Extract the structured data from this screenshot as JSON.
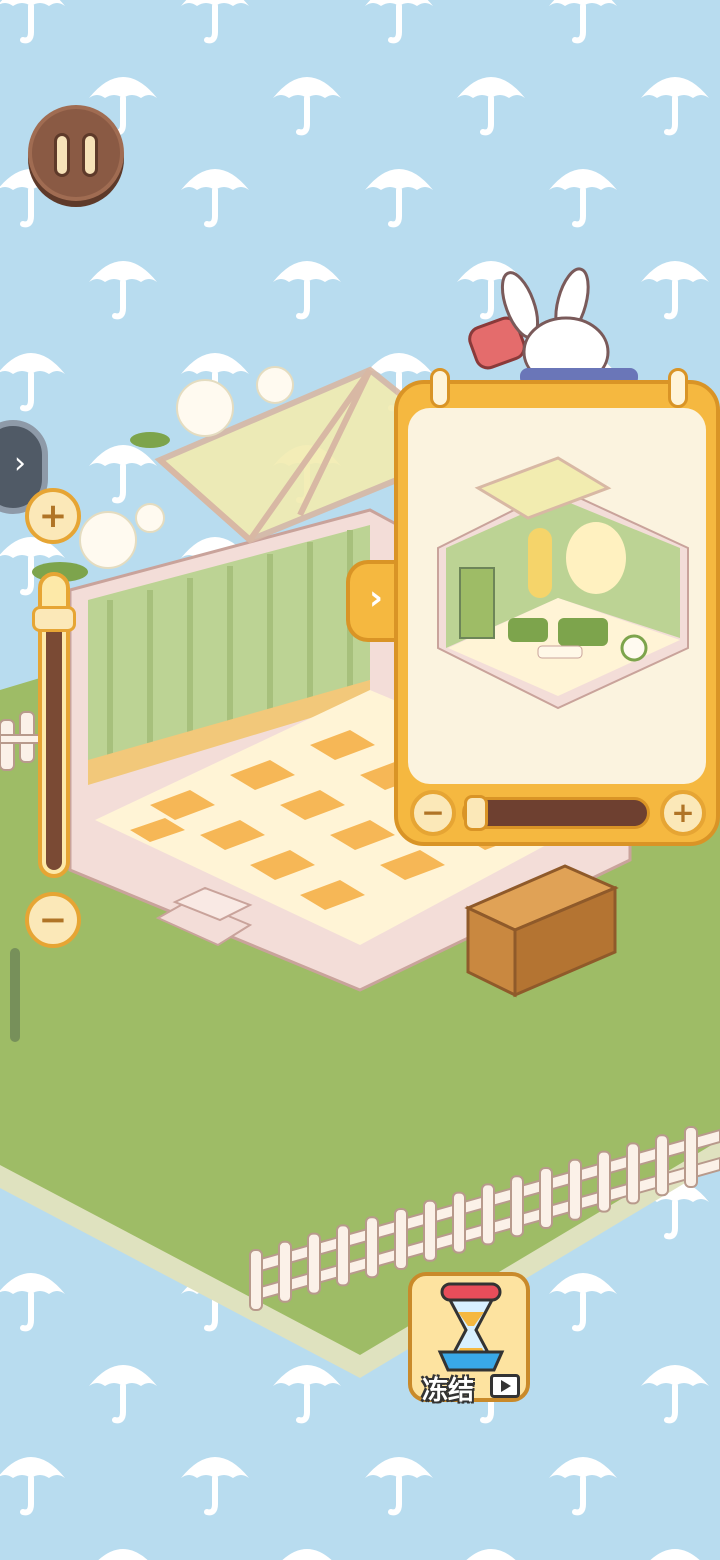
{
  "colors": {
    "sky": "#b8dcef",
    "umbrella": "#ffffff",
    "grass": "#9ebc66",
    "accent": "#f5b840",
    "wood": "#8a5a44"
  },
  "icons": {
    "pause": "pause-icon",
    "expand": "chevron-right-icon",
    "zoom_in": "plus-icon",
    "zoom_out": "minus-icon",
    "collapse_preview": "chevron-right-icon",
    "freeze": "hourglass-icon",
    "video": "video-ad-icon"
  },
  "zoom_slider": {
    "level": 0.9
  },
  "preview": {
    "zoom_level": 0.02
  },
  "freeze": {
    "label": "冻结"
  }
}
